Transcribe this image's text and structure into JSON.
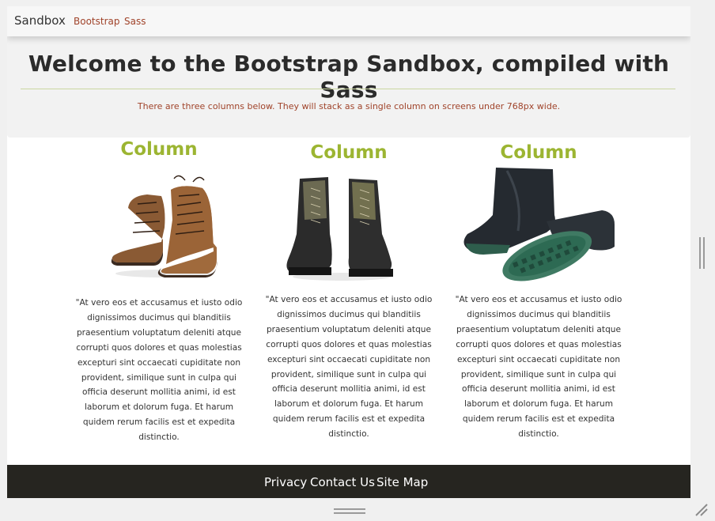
{
  "navbar": {
    "brand": "Sandbox",
    "links": [
      "Bootstrap",
      "Sass"
    ]
  },
  "jumbotron": {
    "title": "Welcome to the Bootstrap Sandbox, compiled with Sass",
    "lead": "There are three columns below. They will stack as a single column on screens under 768px wide."
  },
  "columns": [
    {
      "heading": "Column",
      "image": "brown-leather-boots",
      "text": "\"At vero eos et accusamus et iusto odio dignissimos ducimus qui blanditiis praesentium voluptatum deleniti atque corrupti quos dolores et quas molestias excepturi sint occaecati cupiditate non provident, similique sunt in culpa qui officia deserunt mollitia animi, id est laborum et dolorum fuga. Et harum quidem rerum facilis est et expedita distinctio."
    },
    {
      "heading": "Column",
      "image": "black-combat-boots",
      "text": "\"At vero eos et accusamus et iusto odio dignissimos ducimus qui blanditiis praesentium voluptatum deleniti atque corrupti quos dolores et quas molestias excepturi sint occaecati cupiditate non provident, similique sunt in culpa qui officia deserunt mollitia animi, id est laborum et dolorum fuga. Et harum quidem rerum facilis est et expedita distinctio."
    },
    {
      "heading": "Column",
      "image": "black-rubber-rain-boots",
      "text": "\"At vero eos et accusamus et iusto odio dignissimos ducimus qui blanditiis praesentium voluptatum deleniti atque corrupti quos dolores et quas molestias excepturi sint occaecati cupiditate non provident, similique sunt in culpa qui officia deserunt mollitia animi, id est laborum et dolorum fuga. Et harum quidem rerum facilis est et expedita distinctio."
    }
  ],
  "footer": {
    "links": [
      "Privacy",
      "Contact Us",
      "Site Map"
    ]
  },
  "colors": {
    "accent_green": "#9cb532",
    "link_rust": "#a0432a",
    "footer_bg": "#262520"
  },
  "icons": {
    "vertical_scroll": "scroll-grip-icon",
    "horizontal_resize": "resize-grip-icon",
    "corner_resize": "resize-corner-icon"
  }
}
